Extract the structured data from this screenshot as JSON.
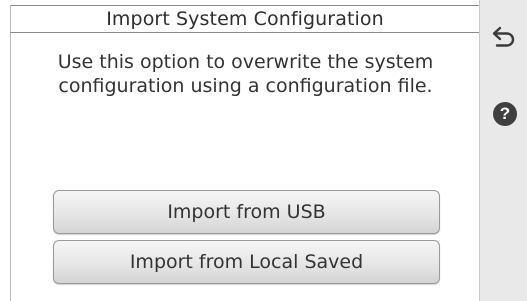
{
  "screen": {
    "title": "Import System Configuration",
    "description": "Use this option to overwrite the system configuration using a configuration file."
  },
  "buttons": {
    "import_usb": "Import from USB",
    "import_local": "Import from Local Saved"
  },
  "side_panel": {
    "back_icon": "back-arrow-icon",
    "help_icon": "help-icon",
    "help_glyph": "?"
  }
}
